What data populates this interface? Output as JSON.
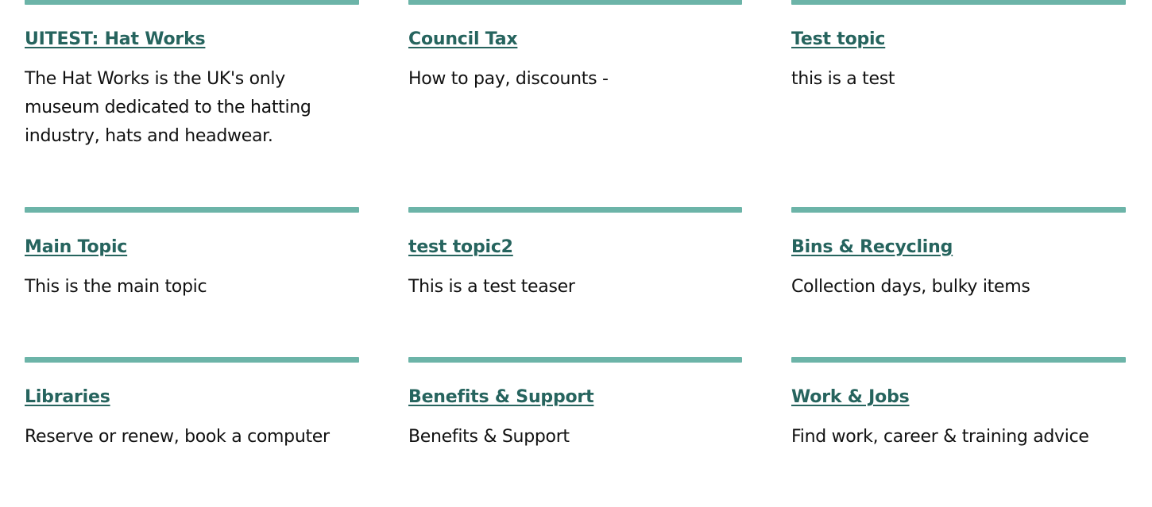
{
  "topics": [
    {
      "title": "UITEST: Hat Works",
      "teaser": "The Hat Works is the UK's only museum dedicated to the hatting industry, hats and headwear."
    },
    {
      "title": "Council Tax",
      "teaser": "How to pay, discounts -"
    },
    {
      "title": "Test topic",
      "teaser": "this is a test"
    },
    {
      "title": "Main Topic",
      "teaser": "This is the main topic"
    },
    {
      "title": "test topic2",
      "teaser": "This is a test teaser"
    },
    {
      "title": "Bins & Recycling",
      "teaser": "Collection days, bulky items"
    },
    {
      "title": "Libraries",
      "teaser": "Reserve or renew, book a computer"
    },
    {
      "title": "Benefits & Support",
      "teaser": "Benefits & Support"
    },
    {
      "title": "Work & Jobs",
      "teaser": "Find work, career & training advice"
    }
  ],
  "colors": {
    "accent_bar": "#6cb4a8",
    "link": "#26645e",
    "text": "#111111"
  }
}
